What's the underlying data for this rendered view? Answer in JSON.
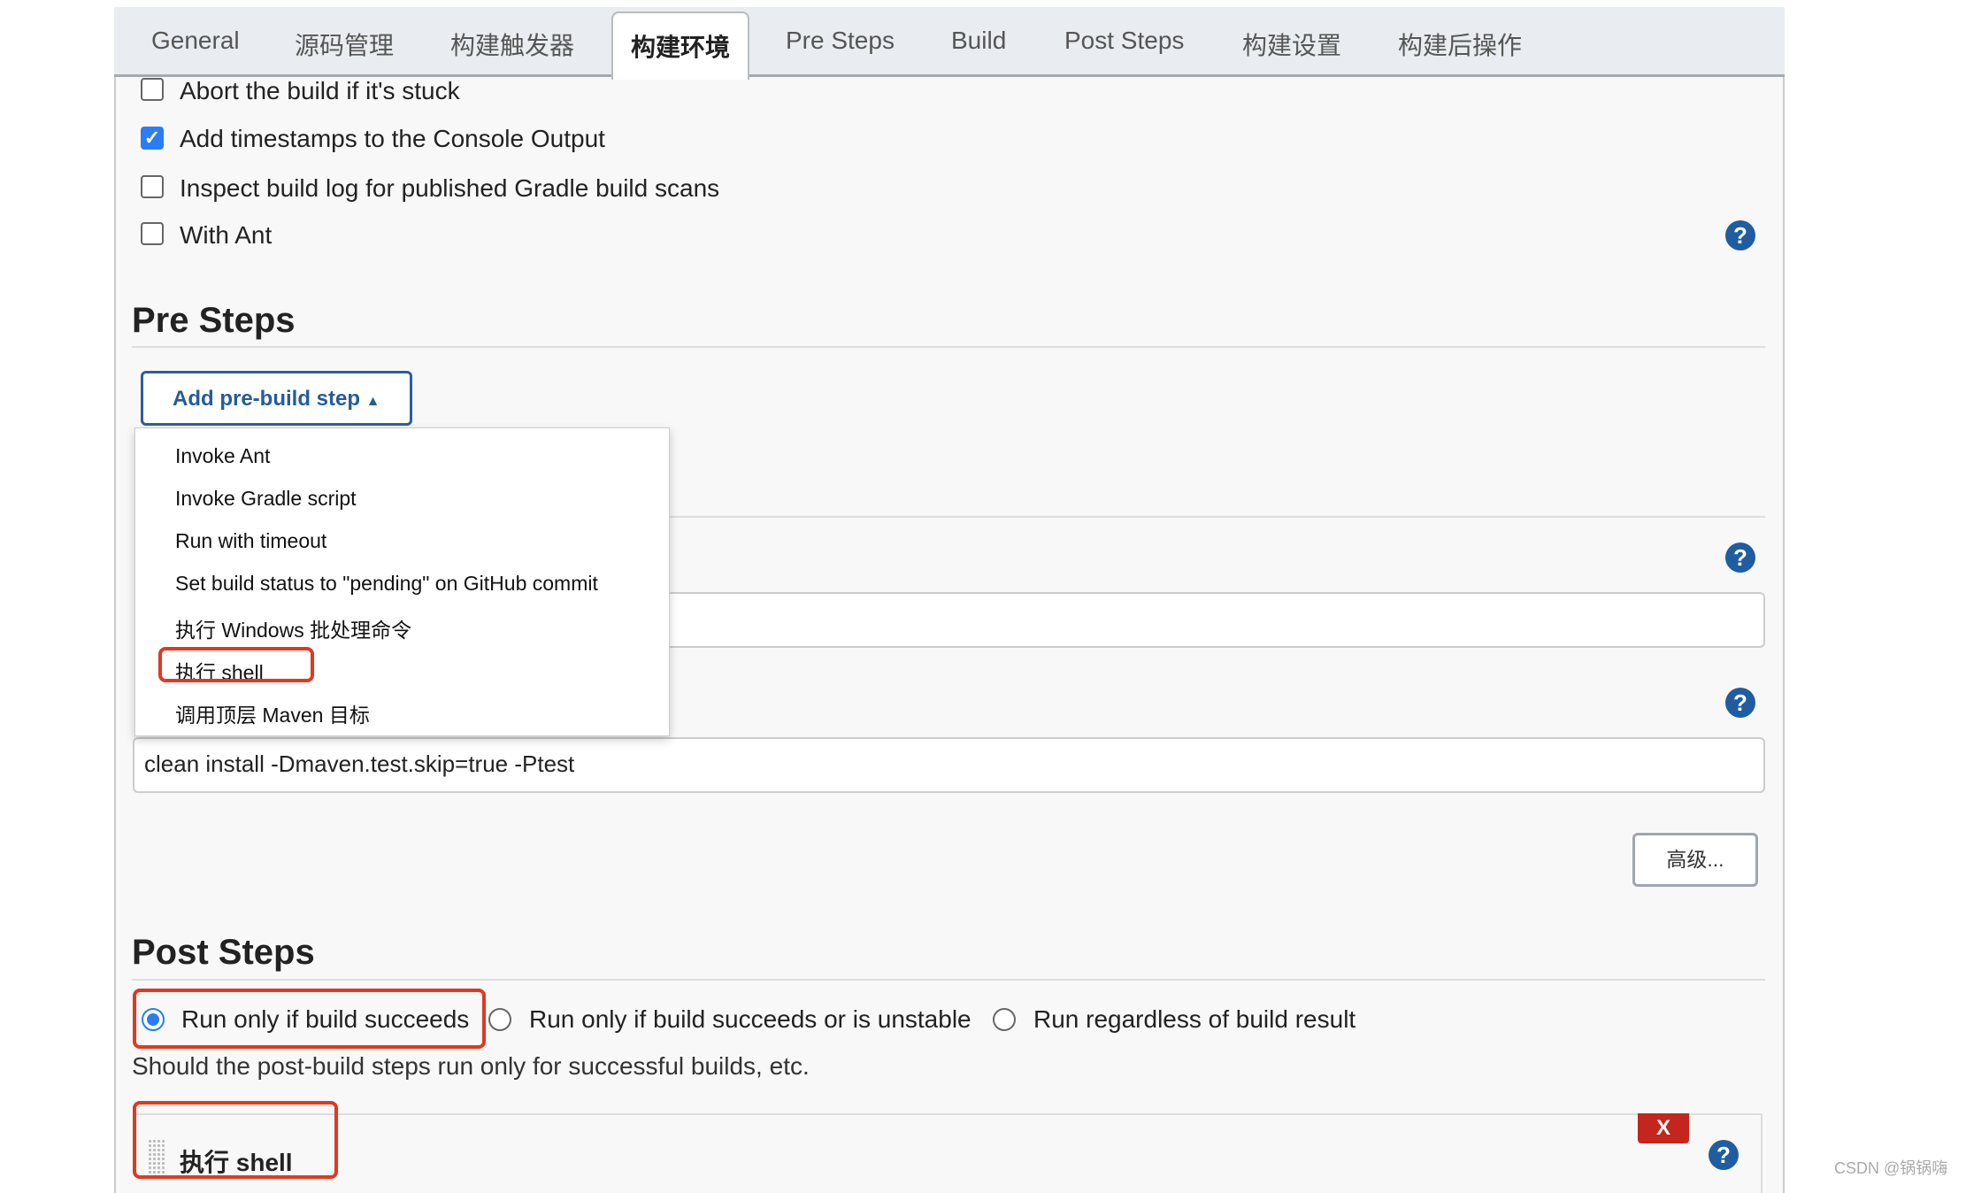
{
  "tabs": [
    "General",
    "源码管理",
    "构建触发器",
    "构建环境",
    "Pre Steps",
    "Build",
    "Post Steps",
    "构建设置",
    "构建后操作"
  ],
  "active_tab": "构建环境",
  "build_env": {
    "options": [
      {
        "label": "Abort the build if it's stuck",
        "checked": false
      },
      {
        "label": "Add timestamps to the Console Output",
        "checked": true
      },
      {
        "label": "Inspect build log for published Gradle build scans",
        "checked": false
      },
      {
        "label": "With Ant",
        "checked": false
      }
    ]
  },
  "pre_steps": {
    "title": "Pre Steps",
    "add_button": "Add pre-build step",
    "menu": [
      "Invoke Ant",
      "Invoke Gradle script",
      "Run with timeout",
      "Set build status to \"pending\" on GitHub commit",
      "执行 Windows 批处理命令",
      "执行 shell",
      "调用顶层 Maven 目标"
    ],
    "goals_value": "clean install -Dmaven.test.skip=true -Ptest",
    "advanced_button": "高级..."
  },
  "post_steps": {
    "title": "Post Steps",
    "radios": [
      {
        "label": "Run only if build succeeds",
        "selected": true
      },
      {
        "label": "Run only if build succeeds or is unstable",
        "selected": false
      },
      {
        "label": "Run regardless of build result",
        "selected": false
      }
    ],
    "description": "Should the post-build steps run only for successful builds, etc.",
    "step_title": "执行 shell",
    "delete_label": "X"
  },
  "help_label": "?",
  "watermark": "CSDN @锅锅嗨",
  "colors": {
    "accent": "#2b5f9e",
    "highlight": "#e0391f",
    "delete": "#c4251d",
    "checkbox": "#2a7cf7"
  }
}
